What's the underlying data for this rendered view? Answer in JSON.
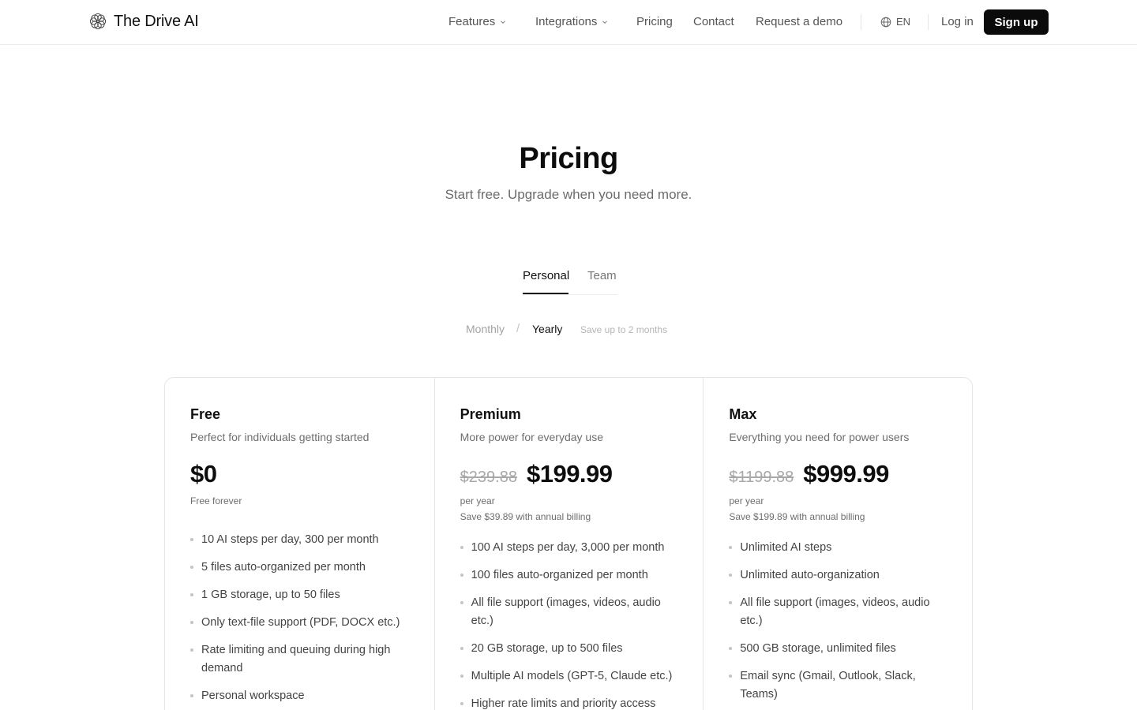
{
  "brand": {
    "name": "The Drive AI",
    "logo_icon": "flower-logo-icon"
  },
  "nav": {
    "items": [
      {
        "label": "Features",
        "has_dropdown": true
      },
      {
        "label": "Integrations",
        "has_dropdown": true
      },
      {
        "label": "Pricing",
        "has_dropdown": false
      },
      {
        "label": "Contact",
        "has_dropdown": false
      },
      {
        "label": "Request a demo",
        "has_dropdown": false
      }
    ],
    "language": "EN",
    "login": "Log in",
    "signup": "Sign up"
  },
  "hero": {
    "title": "Pricing",
    "subtitle": "Start free. Upgrade when you need more."
  },
  "tabs": {
    "items": [
      "Personal",
      "Team"
    ],
    "active": "Personal"
  },
  "billing": {
    "monthly": "Monthly",
    "separator": "/",
    "yearly": "Yearly",
    "active": "Yearly",
    "save_note": "Save up to 2 months"
  },
  "plans": [
    {
      "name": "Free",
      "description": "Perfect for individuals getting started",
      "old_price": "",
      "price": "$0",
      "period": "Free forever",
      "savings": "",
      "features": [
        "10 AI steps per day, 300 per month",
        "5 files auto-organized per month",
        "1 GB storage, up to 50 files",
        "Only text-file support (PDF, DOCX etc.)",
        "Rate limiting and queuing during high demand",
        "Personal workspace"
      ]
    },
    {
      "name": "Premium",
      "description": "More power for everyday use",
      "old_price": "$239.88",
      "price": "$199.99",
      "period": "per year",
      "savings": "Save $39.89 with annual billing",
      "features": [
        "100 AI steps per day, 3,000 per month",
        "100 files auto-organized per month",
        "All file support (images, videos, audio etc.)",
        "20 GB storage, up to 500 files",
        "Multiple AI models (GPT-5, Claude etc.)",
        "Higher rate limits and priority access"
      ]
    },
    {
      "name": "Max",
      "description": "Everything you need for power users",
      "old_price": "$1199.88",
      "price": "$999.99",
      "period": "per year",
      "savings": "Save $199.89 with annual billing",
      "features": [
        "Unlimited AI steps",
        "Unlimited auto-organization",
        "All file support (images, videos, audio etc.)",
        "500 GB storage, unlimited files",
        "Email sync (Gmail, Outlook, Slack, Teams)"
      ]
    }
  ],
  "colors": {
    "primary_button": "#0b0b0b",
    "text": "#111111",
    "muted": "#6e6e6e",
    "border": "#e6e6e6"
  }
}
